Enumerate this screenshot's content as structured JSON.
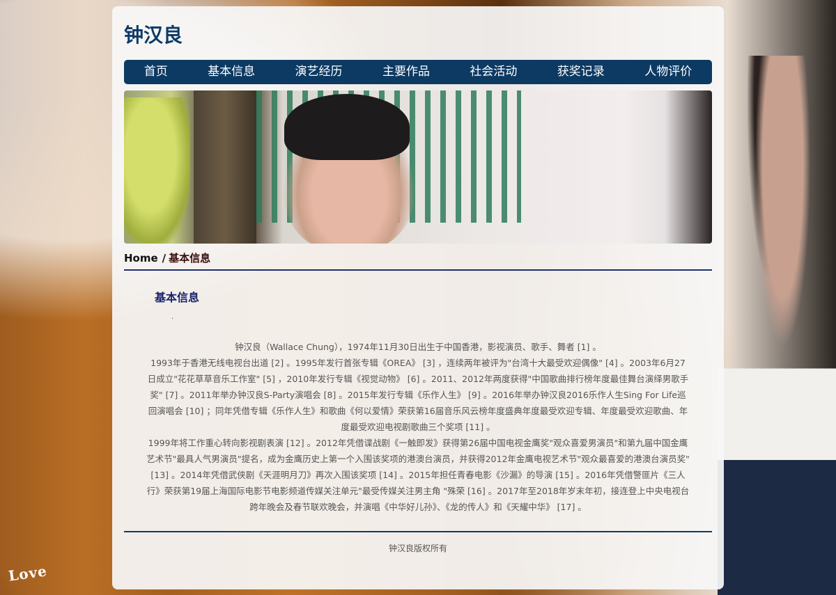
{
  "site": {
    "title": "钟汉良"
  },
  "nav": {
    "items": [
      "首页",
      "基本信息",
      "演艺经历",
      "主要作品",
      "社会活动",
      "获奖记录",
      "人物评价"
    ]
  },
  "breadcrumb": {
    "home": "Home",
    "separator": "/",
    "current": "基本信息"
  },
  "section": {
    "title": "基本信息",
    "dot": "."
  },
  "article": {
    "paragraphs": [
      "钟汉良（Wallace Chung），1974年11月30日出生于中国香港，影视演员、歌手、舞者 [1] 。",
      "1993年于香港无线电视台出道 [2] 。1995年发行首张专辑《OREA》 [3] ，连续两年被评为\"台湾十大最受欢迎偶像\" [4] 。2003年6月27日成立\"花花草草音乐工作室\" [5] ，2010年发行专辑《视觉动物》 [6] 。2011、2012年两度获得\"中国歌曲排行榜年度最佳舞台演绎男歌手奖\" [7] 。2011年举办钟汉良S-Party演唱会 [8] 。2015年发行专辑《乐作人生》 [9] 。2016年举办钟汉良2016乐作人生Sing For Life巡回演唱会 [10] ；同年凭借专辑《乐作人生》和歌曲《何以爱情》荣获第16届音乐风云榜年度盛典年度最受欢迎专辑、年度最受欢迎歌曲、年度最受欢迎电视剧歌曲三个奖项 [11] 。",
      "1999年将工作重心转向影视剧表演 [12] 。2012年凭借谍战剧《一触即发》获得第26届中国电视金鹰奖\"观众喜爱男演员\"和第九届中国金鹰艺术节\"最具人气男演员\"提名，成为金鹰历史上第一个入围该奖项的港澳台演员，并获得2012年金鹰电视艺术节\"观众最喜爱的港澳台演员奖\" [13] 。2014年凭借武侠剧《天涯明月刀》再次入围该奖项 [14] 。2015年担任青春电影《沙漏》的导演 [15] 。2016年凭借警匪片《三人行》荣获第19届上海国际电影节电影频道传媒关注单元\"最受传媒关注男主角 \"殊荣 [16] 。2017年至2018年岁末年初，接连登上中央电视台跨年晚会及春节联欢晚会，并演唱《中华好儿孙》、《龙的传人》和《天耀中华》 [17] 。"
    ]
  },
  "footer": {
    "copyright": "钟汉良版权所有"
  },
  "background": {
    "caption": "Love"
  }
}
